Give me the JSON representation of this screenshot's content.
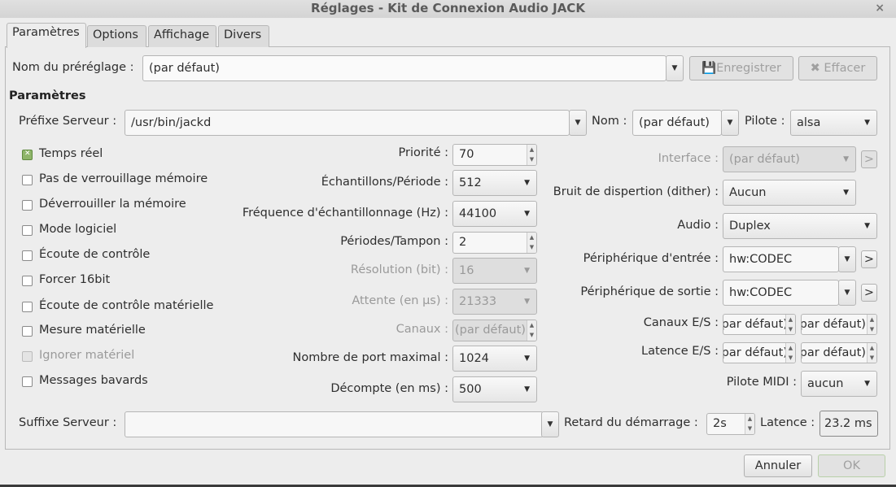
{
  "window": {
    "title": "Réglages - Kit de Connexion Audio JACK",
    "close": "×"
  },
  "tabs": [
    "Paramètres",
    "Options",
    "Affichage",
    "Divers"
  ],
  "preset": {
    "label": "Nom du préréglage :",
    "value": "(par défaut)",
    "save": "Enregistrer",
    "delete": "Effacer"
  },
  "section_title": "Paramètres",
  "server": {
    "prefix_label": "Préfixe Serveur :",
    "prefix_value": "/usr/bin/jackd",
    "name_label": "Nom :",
    "name_value": "(par défaut)",
    "driver_label": "Pilote :",
    "driver_value": "alsa",
    "suffix_label": "Suffixe Serveur :",
    "suffix_value": ""
  },
  "checkboxes": [
    {
      "label": "Temps réel",
      "checked": true,
      "disabled": false
    },
    {
      "label": "Pas de verrouillage mémoire",
      "checked": false,
      "disabled": false
    },
    {
      "label": "Déverrouiller la mémoire",
      "checked": false,
      "disabled": false
    },
    {
      "label": "Mode logiciel",
      "checked": false,
      "disabled": false
    },
    {
      "label": "Écoute de contrôle",
      "checked": false,
      "disabled": false
    },
    {
      "label": "Forcer 16bit",
      "checked": false,
      "disabled": false
    },
    {
      "label": "Écoute de contrôle matérielle",
      "checked": false,
      "disabled": false
    },
    {
      "label": "Mesure matérielle",
      "checked": false,
      "disabled": false
    },
    {
      "label": "Ignorer matériel",
      "checked": false,
      "disabled": true
    },
    {
      "label": "Messages bavards",
      "checked": false,
      "disabled": false
    }
  ],
  "middle": [
    {
      "label": "Priorité :",
      "value": "70"
    },
    {
      "label": "Échantillons/Période :",
      "value": "512"
    },
    {
      "label": "Fréquence d'échantillonnage (Hz) :",
      "value": "44100"
    },
    {
      "label": "Périodes/Tampon :",
      "value": "2"
    },
    {
      "label": "Résolution (bit) :",
      "value": "16"
    },
    {
      "label": "Attente (en µs) :",
      "value": "21333"
    },
    {
      "label": "Canaux :",
      "value": "(par défaut)"
    },
    {
      "label": "Nombre de port maximal :",
      "value": "1024"
    },
    {
      "label": "Décompte (en ms) :",
      "value": "500"
    }
  ],
  "right": {
    "interface_label": "Interface :",
    "interface_value": "(par défaut)",
    "dither_label": "Bruit de dispertion (dither) :",
    "dither_value": "Aucun",
    "audio_label": "Audio :",
    "audio_value": "Duplex",
    "input_label": "Périphérique d'entrée :",
    "input_value": "hw:CODEC",
    "output_label": "Périphérique de sortie :",
    "output_value": "hw:CODEC",
    "channels_label": "Canaux E/S :",
    "channels_in": "(par défaut)",
    "channels_out": "(par défaut)",
    "latency_label": "Latence E/S :",
    "latency_in": "(par défaut)",
    "latency_out": "(par défaut)",
    "midi_label": "Pilote MIDI :",
    "midi_value": "aucun",
    "more": ">"
  },
  "bottom": {
    "delay_label": "Retard du démarrage :",
    "delay_value": "2s",
    "latency_label": "Latence :",
    "latency_value": "23.2 ms"
  },
  "buttons": {
    "cancel": "Annuler",
    "ok": "OK"
  }
}
